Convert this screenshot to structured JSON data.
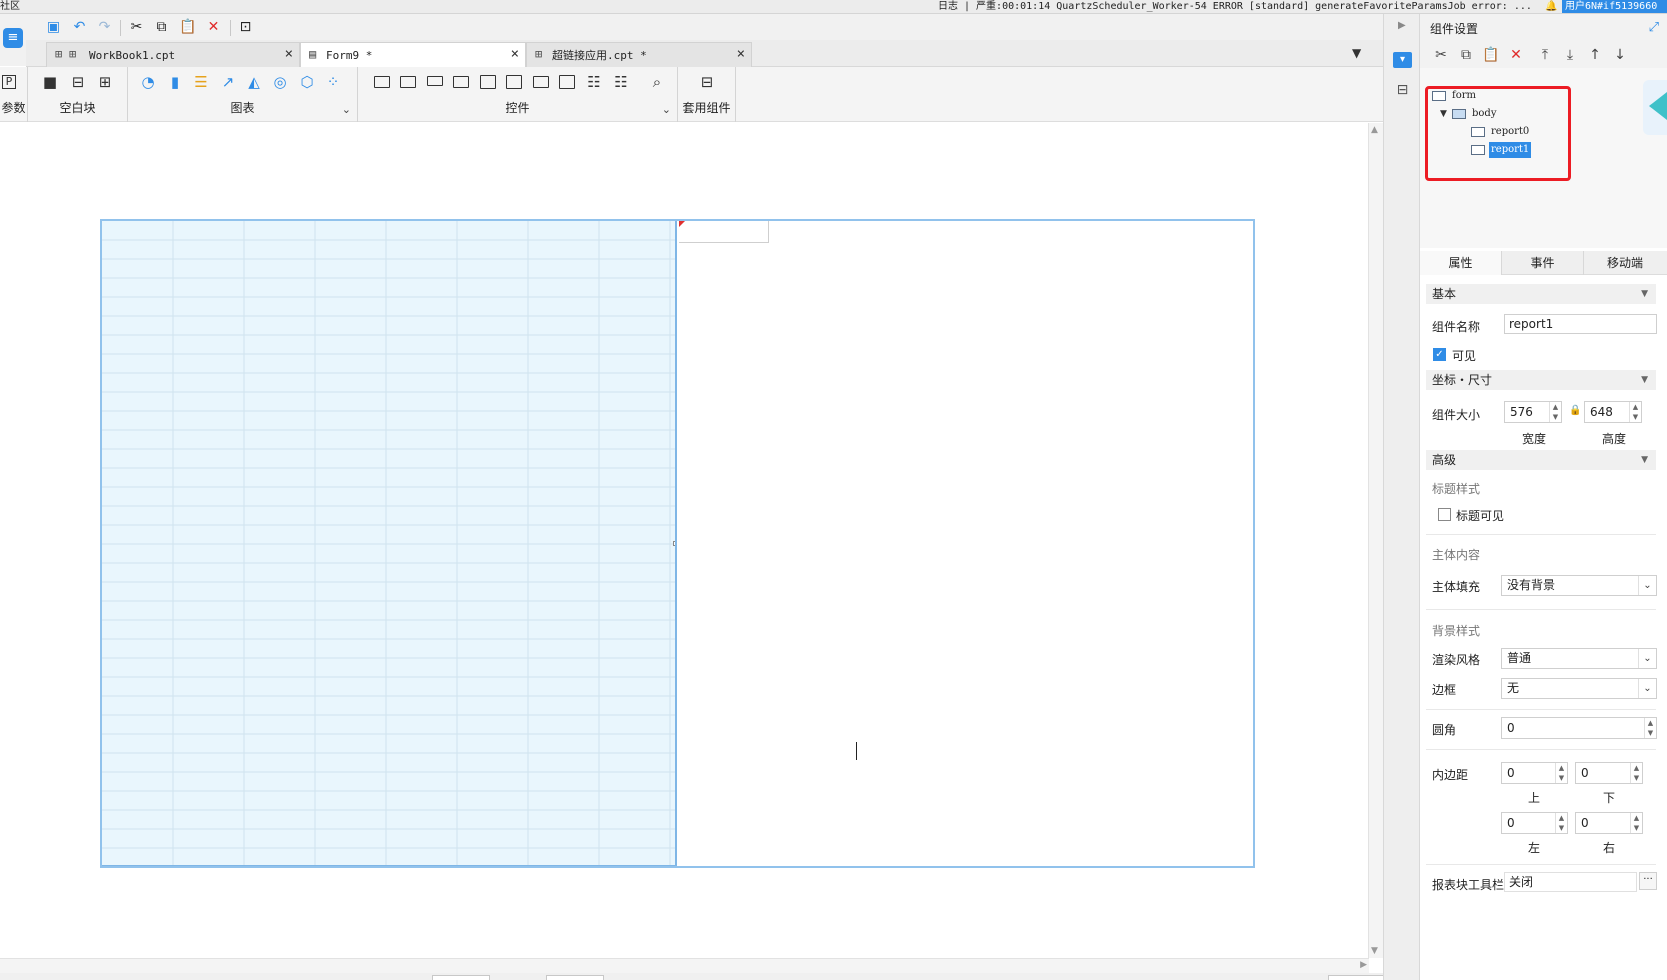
{
  "topbar": {
    "left_text": "社区",
    "status_text": "日志 | 严重:00:01:14 QuartzScheduler_Worker-54 ERROR [standard] generateFavoriteParamsJob error: ...",
    "user_text": "用户6N#if5139660"
  },
  "tabs": [
    {
      "label": "WorkBook1.cpt",
      "icon": "grid-file-icon",
      "active": false
    },
    {
      "label": "Form9 *",
      "icon": "form-file-icon",
      "active": true
    },
    {
      "label": "超链接应用.cpt *",
      "icon": "grid-file-icon",
      "active": false
    }
  ],
  "ribbon": {
    "params_label": "参数",
    "blank_label": "空白块",
    "chart_label": "图表",
    "controls_label": "控件",
    "suite_label": "套用组件"
  },
  "panel": {
    "title": "组件设置",
    "tree": {
      "root": "form",
      "body": "body",
      "children": [
        "report0",
        "report1"
      ],
      "selected": "report1"
    },
    "tabs": [
      "属性",
      "事件",
      "移动端"
    ],
    "sections": {
      "basic": "基本",
      "coords": "坐标・尺寸",
      "advanced": "高级"
    },
    "fields": {
      "name_label": "组件名称",
      "name_value": "report1",
      "visible_label": "可见",
      "size_label": "组件大小",
      "width_value": "576",
      "height_value": "648",
      "width_label": "宽度",
      "height_label": "高度",
      "title_style_label": "标题样式",
      "title_visible_label": "标题可见",
      "body_content_label": "主体内容",
      "body_fill_label": "主体填充",
      "body_fill_value": "没有背景",
      "bg_style_label": "背景样式",
      "render_label": "渲染风格",
      "render_value": "普通",
      "border_label": "边框",
      "border_value": "无",
      "radius_label": "圆角",
      "radius_value": "0",
      "padding_label": "内边距",
      "pad_top": "0",
      "pad_bottom": "0",
      "pad_left": "0",
      "pad_right": "0",
      "top_label": "上",
      "bottom_label": "下",
      "left_label": "左",
      "right_label": "右",
      "toolbar_label": "报表块工具栏",
      "toolbar_value": "关闭"
    }
  },
  "colors": {
    "accent": "#2f8ce6",
    "annotation_red": "#ec1c24",
    "report_fill": "#e9f6fd"
  }
}
